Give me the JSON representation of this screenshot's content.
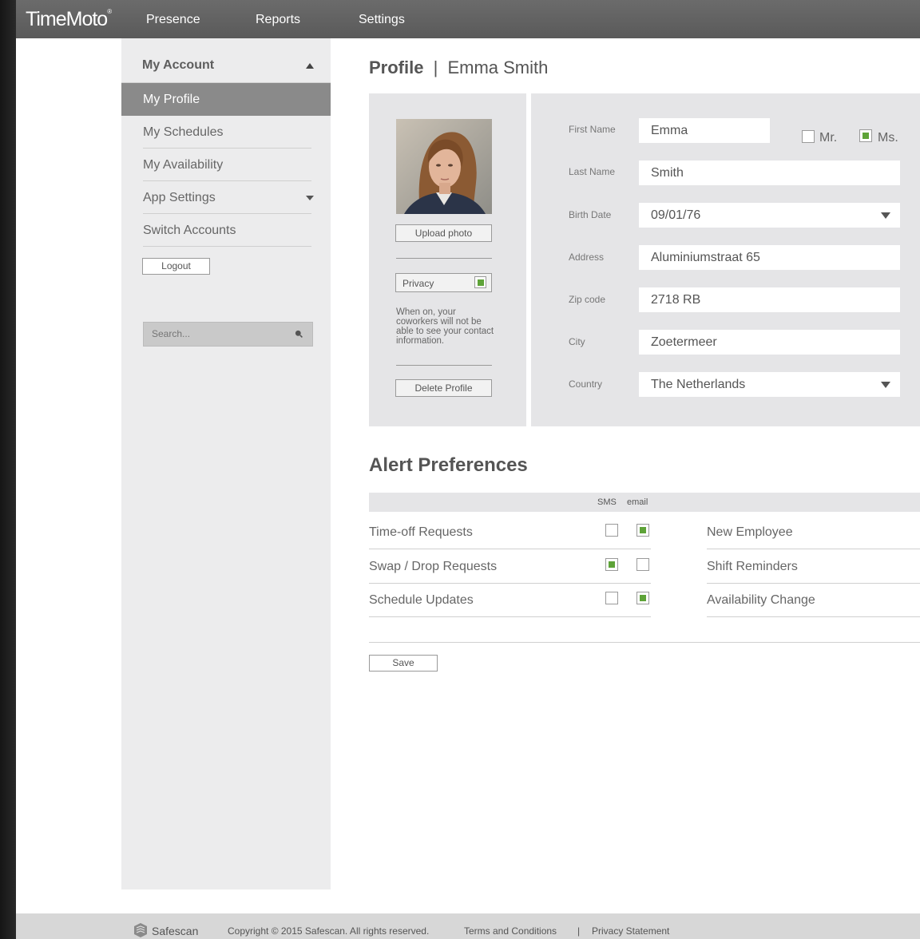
{
  "app": {
    "logo": "TimeMoto",
    "logo_mark": "®"
  },
  "nav": {
    "items": [
      "Presence",
      "Reports",
      "Settings"
    ]
  },
  "sidebar": {
    "header": "My Account",
    "items": [
      {
        "label": "My Profile",
        "active": true
      },
      {
        "label": "My Schedules",
        "active": false
      },
      {
        "label": "My Availability",
        "active": false
      },
      {
        "label": "App Settings",
        "active": false
      },
      {
        "label": "Switch Accounts",
        "active": false
      }
    ],
    "logout_label": "Logout",
    "search_placeholder": "Search..."
  },
  "profile": {
    "title": "Profile",
    "separator": "|",
    "name": "Emma Smith",
    "upload_label": "Upload photo",
    "privacy_label": "Privacy",
    "privacy_checked": true,
    "privacy_note": "When on, your coworkers will not be able to see your contact information.",
    "delete_label": "Delete Profile",
    "title_options": [
      {
        "label": "Mr.",
        "checked": false
      },
      {
        "label": "Ms.",
        "checked": true
      }
    ],
    "fields": [
      {
        "label": "First Name",
        "value": "Emma"
      },
      {
        "label": "Last Name",
        "value": "Smith"
      },
      {
        "label": "Birth Date",
        "value": "09/01/76"
      },
      {
        "label": "Address",
        "value": "Aluminiumstraat 65"
      },
      {
        "label": "Zip code",
        "value": "2718 RB"
      },
      {
        "label": "City",
        "value": "Zoetermeer"
      },
      {
        "label": "Country",
        "value": "The Netherlands"
      }
    ]
  },
  "alerts": {
    "title": "Alert Preferences",
    "col_sms": "SMS",
    "col_email": "email",
    "rows_left": [
      {
        "label": "Time-off Requests",
        "sms": false,
        "email": true
      },
      {
        "label": "Swap / Drop Requests",
        "sms": true,
        "email": false
      },
      {
        "label": "Schedule Updates",
        "sms": false,
        "email": true
      }
    ],
    "rows_right": [
      {
        "label": "New Employee"
      },
      {
        "label": "Shift Reminders"
      },
      {
        "label": "Availability Change"
      }
    ],
    "save_label": "Save"
  },
  "footer": {
    "brand": "Safescan",
    "copyright": "Copyright © 2015 Safescan. All rights reserved.",
    "terms": "Terms and Conditions",
    "divider": "|",
    "privacy": "Privacy Statement"
  },
  "colors": {
    "accent_green": "#5ea338",
    "nav_bg": "#5f5f5f",
    "sidebar_bg": "#ececed",
    "active_item": "#8a8a8a"
  }
}
